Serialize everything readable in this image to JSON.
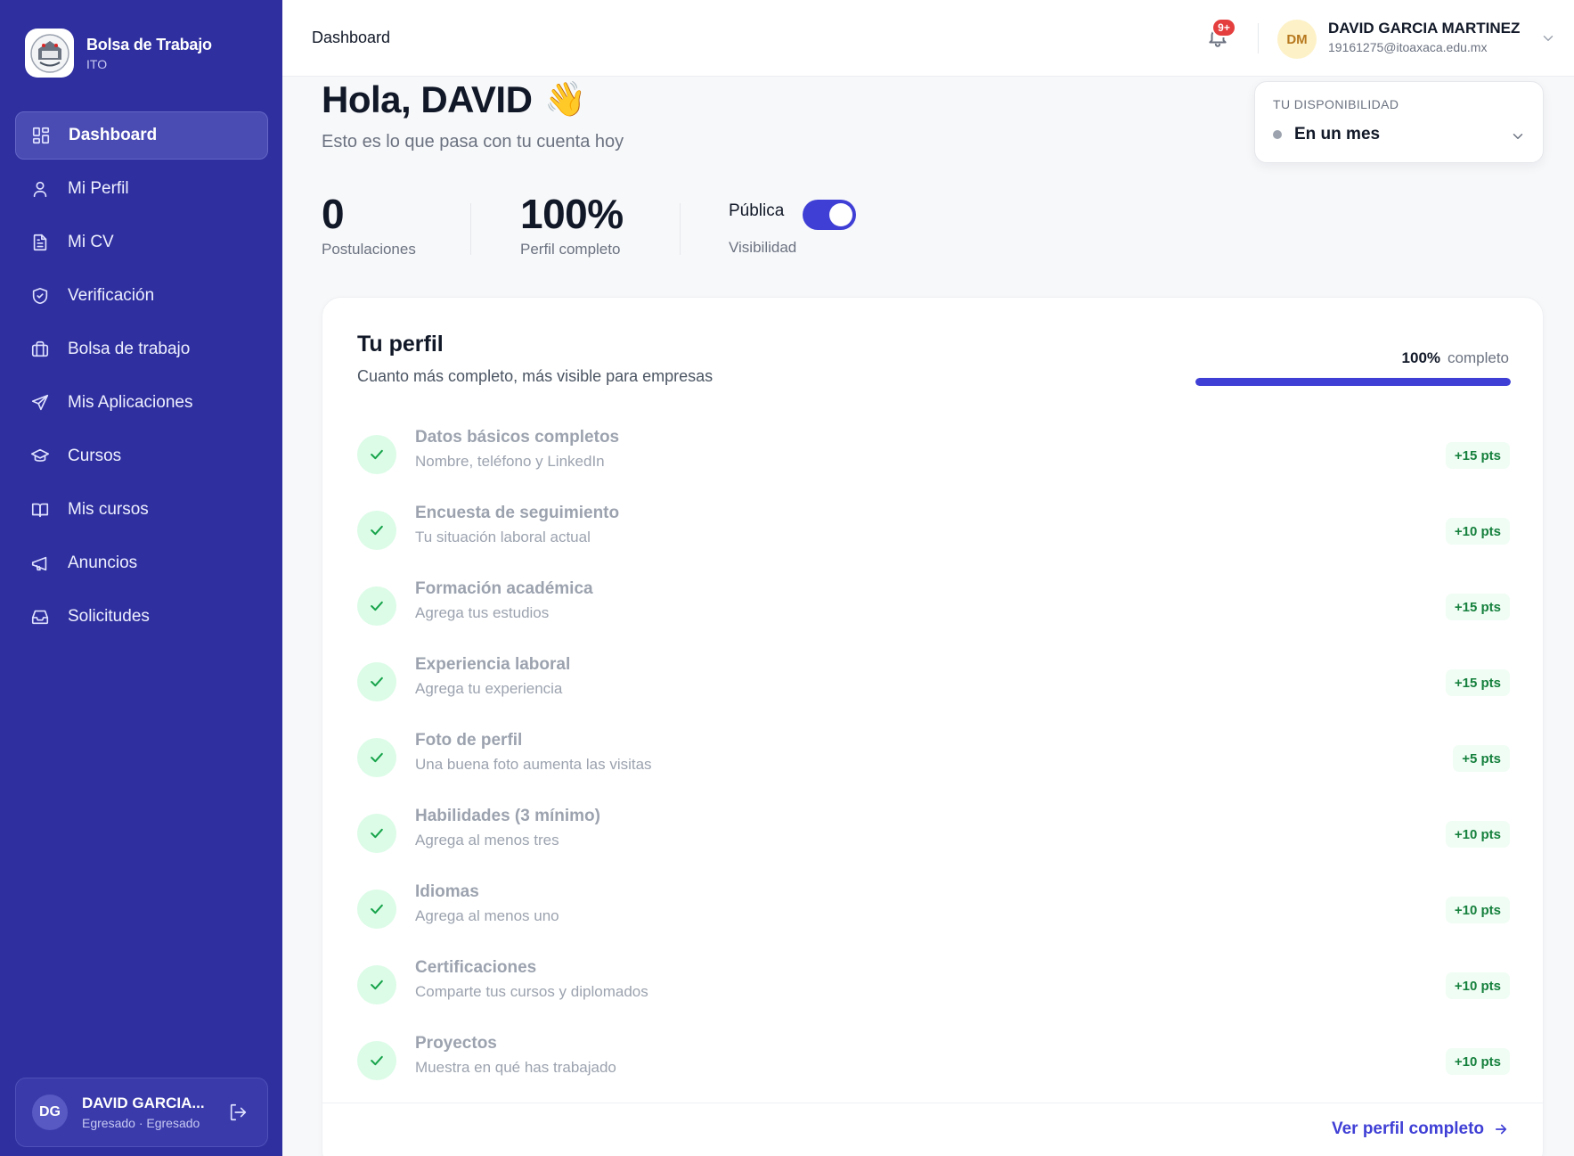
{
  "sidebar": {
    "brand_title": "Bolsa de Trabajo",
    "brand_sub": "ITO",
    "items": [
      {
        "label": "Dashboard",
        "icon": "grid-icon",
        "active": true
      },
      {
        "label": "Mi Perfil",
        "icon": "user-icon"
      },
      {
        "label": "Mi CV",
        "icon": "document-icon"
      },
      {
        "label": "Verificación",
        "icon": "shield-check-icon"
      },
      {
        "label": "Bolsa de trabajo",
        "icon": "briefcase-icon"
      },
      {
        "label": "Mis Aplicaciones",
        "icon": "send-icon"
      },
      {
        "label": "Cursos",
        "icon": "graduation-cap-icon"
      },
      {
        "label": "Mis cursos",
        "icon": "book-open-icon"
      },
      {
        "label": "Anuncios",
        "icon": "megaphone-icon"
      },
      {
        "label": "Solicitudes",
        "icon": "inbox-icon"
      }
    ],
    "user": {
      "initials": "DG",
      "name": "DAVID GARCIA...",
      "role": "Egresado · Egresado"
    }
  },
  "topbar": {
    "title": "Dashboard",
    "notifications_badge": "9+",
    "avatar_initials": "DM",
    "user_name": "DAVID GARCIA MARTINEZ",
    "user_email": "19161275@itoaxaca.edu.mx"
  },
  "greeting": {
    "title": "Hola, DAVID",
    "emoji": "👋",
    "subtitle": "Esto es lo que pasa con tu cuenta hoy"
  },
  "availability": {
    "label": "TU DISPONIBILIDAD",
    "value": "En un mes"
  },
  "stats": {
    "applications_value": "0",
    "applications_label": "Postulaciones",
    "profile_value": "100%",
    "profile_label": "Perfil completo",
    "visibility_value": "Pública",
    "visibility_label": "Visibilidad",
    "visibility_on": true
  },
  "profile": {
    "title": "Tu perfil",
    "subtitle": "Cuanto más completo, más visible para empresas",
    "progress_value": "100%",
    "progress_label": "completo",
    "progress_fraction": 1.0,
    "tasks": [
      {
        "title": "Datos básicos completos",
        "desc": "Nombre, teléfono y LinkedIn",
        "pts": "+15 pts"
      },
      {
        "title": "Encuesta de seguimiento",
        "desc": "Tu situación laboral actual",
        "pts": "+10 pts"
      },
      {
        "title": "Formación académica",
        "desc": "Agrega tus estudios",
        "pts": "+15 pts"
      },
      {
        "title": "Experiencia laboral",
        "desc": "Agrega tu experiencia",
        "pts": "+15 pts"
      },
      {
        "title": "Foto de perfil",
        "desc": "Una buena foto aumenta las visitas",
        "pts": "+5 pts"
      },
      {
        "title": "Habilidades (3 mínimo)",
        "desc": "Agrega al menos tres",
        "pts": "+10 pts"
      },
      {
        "title": "Idiomas",
        "desc": "Agrega al menos uno",
        "pts": "+10 pts"
      },
      {
        "title": "Certificaciones",
        "desc": "Comparte tus cursos y diplomados",
        "pts": "+10 pts"
      },
      {
        "title": "Proyectos",
        "desc": "Muestra en qué has trabajado",
        "pts": "+10 pts"
      }
    ],
    "footer_link": "Ver perfil completo"
  },
  "colors": {
    "sidebar_bg": "#2f2f9f",
    "accent": "#3f3fd6",
    "success": "#16a34a"
  }
}
